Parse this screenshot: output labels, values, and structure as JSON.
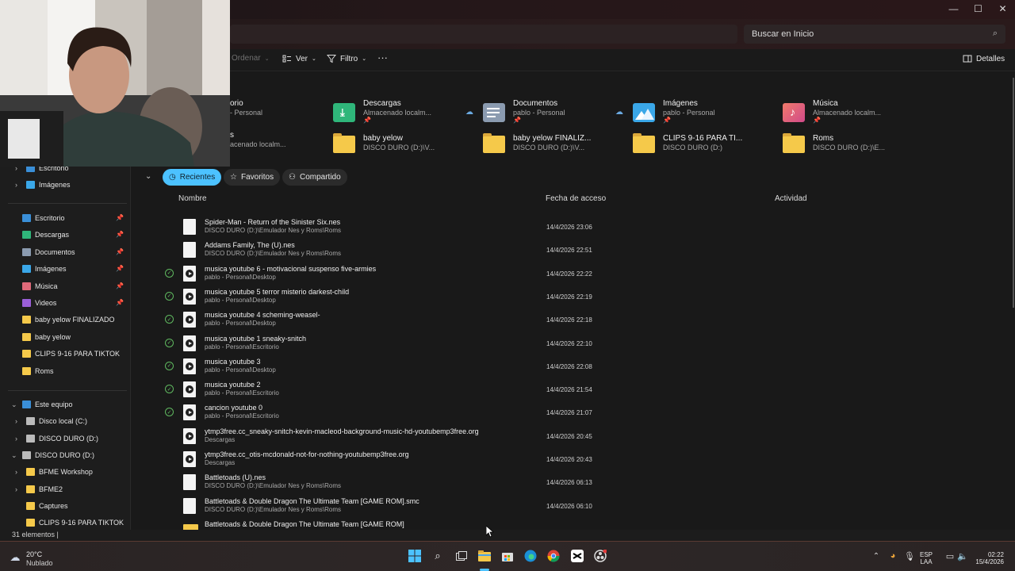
{
  "window": {
    "controls": {
      "minimize": "—",
      "maximize": "☐",
      "close": "✕"
    }
  },
  "search": {
    "placeholder": "Buscar en Inicio"
  },
  "commandbar": {
    "sort": "Ordenar",
    "view": "Ver",
    "filter": "Filtro",
    "more": "···",
    "details": "Detalles"
  },
  "quick_access": [
    {
      "name": "orio",
      "sub": "- Personal",
      "pinned": true
    },
    {
      "name": "Descargas",
      "sub": "Almacenado localm...",
      "pinned": true,
      "icon": "download-folder-icon"
    },
    {
      "name": "Documentos",
      "sub": "pablo - Personal",
      "pinned": true,
      "icon": "documents-folder-icon",
      "cloud": true
    },
    {
      "name": "Imágenes",
      "sub": "pablo - Personal",
      "pinned": true,
      "icon": "pictures-folder-icon",
      "cloud": true
    },
    {
      "name": "Música",
      "sub": "Almacenado localm...",
      "pinned": true,
      "icon": "music-folder-icon"
    },
    {
      "name": "s",
      "sub": "acenado localm..."
    },
    {
      "name": "baby yelow",
      "sub": "DISCO DURO (D:)\\V..."
    },
    {
      "name": "baby yelow FINALIZ...",
      "sub": "DISCO DURO (D:)\\V..."
    },
    {
      "name": "CLIPS 9-16 PARA TI...",
      "sub": "DISCO DURO (D:)"
    },
    {
      "name": "Roms",
      "sub": "DISCO DURO (D:)\\E..."
    }
  ],
  "filter_tabs": [
    {
      "label": "Recientes",
      "active": true
    },
    {
      "label": "Favoritos",
      "active": false
    },
    {
      "label": "Compartido",
      "active": false
    }
  ],
  "columns": {
    "name": "Nombre",
    "date": "Fecha de acceso",
    "activity": "Actividad"
  },
  "files": [
    {
      "name": "Spider-Man - Return of the Sinister Six.nes",
      "location": "DISCO DURO (D:)\\Emulador Nes y Roms\\Roms",
      "date": "14/4/2026 23:06",
      "synced": false,
      "type": "doc"
    },
    {
      "name": "Addams Family, The (U).nes",
      "location": "DISCO DURO (D:)\\Emulador Nes y Roms\\Roms",
      "date": "14/4/2026 22:51",
      "synced": false,
      "type": "doc"
    },
    {
      "name": "musica youtube 6 - motivacional suspenso five-armies",
      "location": "pablo - Personal\\Desktop",
      "date": "14/4/2026 22:22",
      "synced": true,
      "type": "media"
    },
    {
      "name": "musica youtube 5 terror misterio darkest-child",
      "location": "pablo - Personal\\Desktop",
      "date": "14/4/2026 22:19",
      "synced": true,
      "type": "media"
    },
    {
      "name": "musica youtube 4 scheming-weasel-",
      "location": "pablo - Personal\\Desktop",
      "date": "14/4/2026 22:18",
      "synced": true,
      "type": "media"
    },
    {
      "name": "musica youtube 1 sneaky-snitch",
      "location": "pablo - Personal\\Escritorio",
      "date": "14/4/2026 22:10",
      "synced": true,
      "type": "media"
    },
    {
      "name": "musica youtube 3",
      "location": "pablo - Personal\\Desktop",
      "date": "14/4/2026 22:08",
      "synced": true,
      "type": "media"
    },
    {
      "name": "musica youtube 2",
      "location": "pablo - Personal\\Escritorio",
      "date": "14/4/2026 21:54",
      "synced": true,
      "type": "media"
    },
    {
      "name": "cancion youtube 0",
      "location": "pablo - Personal\\Escritorio",
      "date": "14/4/2026 21:07",
      "synced": true,
      "type": "media"
    },
    {
      "name": "ytmp3free.cc_sneaky-snitch-kevin-macleod-background-music-hd-youtubemp3free.org",
      "location": "Descargas",
      "date": "14/4/2026 20:45",
      "synced": false,
      "type": "media"
    },
    {
      "name": "ytmp3free.cc_otis-mcdonald-not-for-nothing-youtubemp3free.org",
      "location": "Descargas",
      "date": "14/4/2026 20:43",
      "synced": false,
      "type": "media"
    },
    {
      "name": "Battletoads (U).nes",
      "location": "DISCO DURO (D:)\\Emulador Nes y Roms\\Roms",
      "date": "14/4/2026 06:13",
      "synced": false,
      "type": "doc"
    },
    {
      "name": "Battletoads & Double Dragon The Ultimate Team  [GAME ROM].smc",
      "location": "DISCO DURO (D:)\\Emulador Nes y Roms\\Roms",
      "date": "14/4/2026 06:10",
      "synced": false,
      "type": "doc"
    },
    {
      "name": "Battletoads & Double Dragon The Ultimate Team  [GAME ROM]",
      "location": "",
      "date": "",
      "synced": false,
      "type": "folder"
    }
  ],
  "sidebar": {
    "top": [
      {
        "label": "Escritorio",
        "chevron": true
      },
      {
        "label": "Imágenes",
        "chevron": true
      }
    ],
    "pinned": [
      {
        "label": "Escritorio",
        "pin": true
      },
      {
        "label": "Descargas",
        "pin": true
      },
      {
        "label": "Documentos",
        "pin": true
      },
      {
        "label": "Imágenes",
        "pin": true
      },
      {
        "label": "Música",
        "pin": true
      },
      {
        "label": "Videos",
        "pin": true
      },
      {
        "label": "baby yelow FINALIZADO",
        "pin": false
      },
      {
        "label": "baby yelow",
        "pin": false
      },
      {
        "label": "CLIPS 9-16 PARA TIKTOK",
        "pin": false
      },
      {
        "label": "Roms",
        "pin": false
      }
    ],
    "tree": [
      {
        "label": "Este equipo",
        "chevron": "v"
      },
      {
        "label": "Disco local (C:)",
        "chevron": ">"
      },
      {
        "label": "DISCO DURO (D:)",
        "chevron": ">"
      },
      {
        "label": "DISCO DURO (D:)",
        "chevron": "v"
      },
      {
        "label": "BFME Workshop",
        "chevron": ">"
      },
      {
        "label": "BFME2",
        "chevron": ">"
      },
      {
        "label": "Captures",
        "chevron": ""
      },
      {
        "label": "CLIPS 9-16 PARA TIKTOK",
        "chevron": ""
      }
    ]
  },
  "status": {
    "count": "31 elementos  |"
  },
  "taskbar": {
    "weather_temp": "20°C",
    "weather_cond": "Nublado",
    "lang1": "ESP",
    "lang2": "LAA",
    "time": "02:22",
    "date": "15/4/2026"
  },
  "colors": {
    "accent": "#4cc2ff",
    "folder": "#f5c94a",
    "sync": "#5fb85f"
  }
}
